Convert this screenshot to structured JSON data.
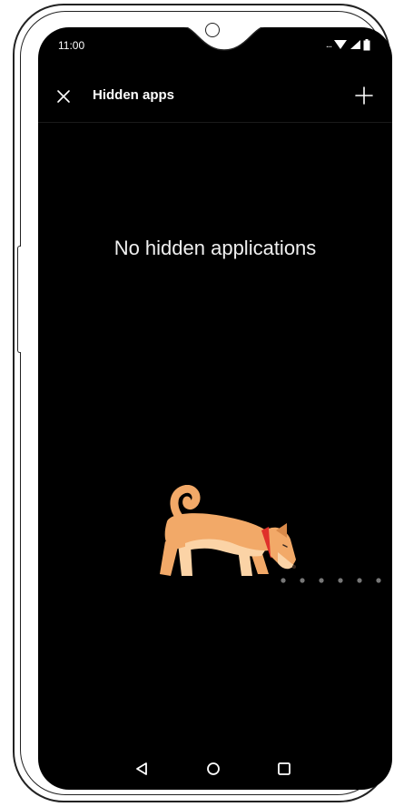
{
  "status_bar": {
    "time": "11:00",
    "overflow": "...",
    "icons": [
      "wifi-icon",
      "signal-icon",
      "battery-icon"
    ]
  },
  "toolbar": {
    "title": "Hidden apps",
    "close_icon": "close-icon",
    "add_icon": "plus-icon"
  },
  "main": {
    "empty_message": "No hidden applications",
    "illustration": "dog-sniffing-illustration"
  },
  "nav_bar": {
    "icons": [
      "back-icon",
      "home-icon",
      "recents-icon"
    ]
  },
  "colors": {
    "background": "#000000",
    "text": "#ffffff",
    "dog_body": "#f2a968",
    "dog_light": "#fbd3a6",
    "collar": "#e0302a"
  }
}
